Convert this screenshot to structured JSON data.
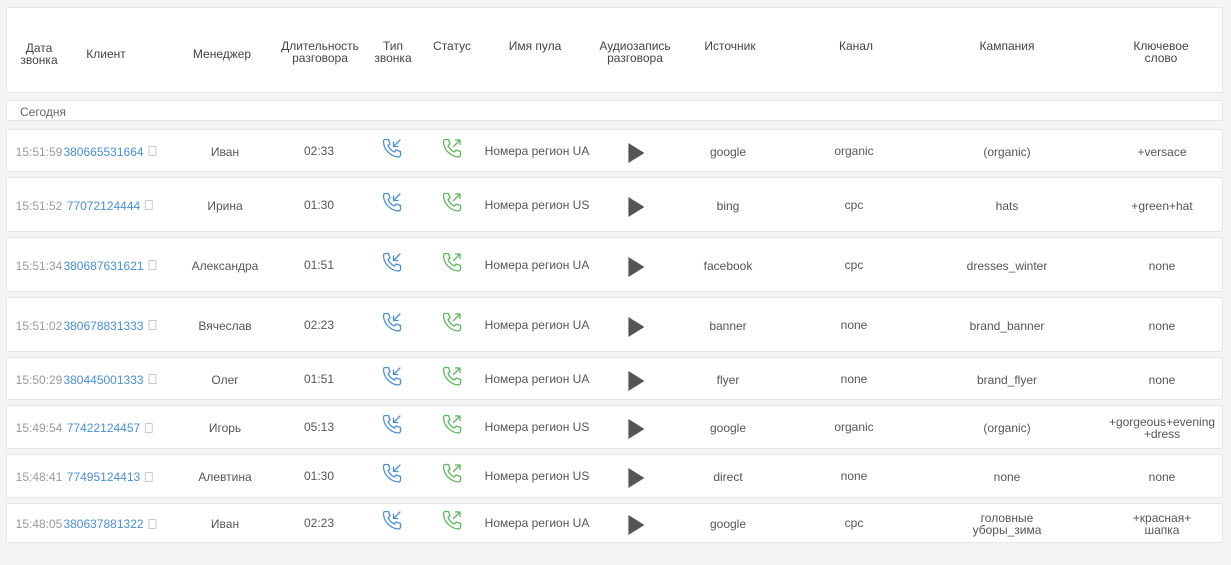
{
  "header": {
    "date": [
      "Дата",
      "звонка"
    ],
    "client": "Клиент",
    "manager": "Менеджер",
    "duration": [
      "Длительность",
      "разговора"
    ],
    "type": [
      "Тип",
      "звонка"
    ],
    "status": "Статус",
    "pool": "Имя пула",
    "audio": [
      "Аудиозапись",
      "разговора"
    ],
    "source": "Источник",
    "channel": "Канал",
    "campaign": "Кампания",
    "keyword": [
      "Ключевое",
      "слово"
    ]
  },
  "group_label": "Сегодня",
  "icons": {
    "call_type": "incoming-call-icon",
    "status": "answered-call-icon",
    "audio": "play-icon",
    "copy": "copy-icon"
  },
  "colors": {
    "phone_link": "#4a8fd6",
    "incoming_icon": "#4a8fd6",
    "status_icon": "#5cb85c"
  },
  "rows": [
    {
      "time": "15:51:59",
      "phone": "380665531664",
      "manager": "Иван",
      "duration": "02:33",
      "pool": "Номера регион UA",
      "source": "google",
      "channel": "organic",
      "campaign": [
        "(organic)"
      ],
      "keyword": [
        "+versace"
      ]
    },
    {
      "time": "15:51:52",
      "phone": "77072124444",
      "manager": "Ирина",
      "duration": "01:30",
      "pool": "Номера регион US",
      "source": "bing",
      "channel": "cpc",
      "campaign": [
        "hats"
      ],
      "keyword": [
        "+green+hat"
      ]
    },
    {
      "time": "15:51:34",
      "phone": "380687631621",
      "manager": "Александра",
      "duration": "01:51",
      "pool": "Номера регион UA",
      "source": "facebook",
      "channel": "cpc",
      "campaign": [
        "dresses_winter"
      ],
      "keyword": [
        "none"
      ]
    },
    {
      "time": "15:51:02",
      "phone": "380678831333",
      "manager": "Вячеслав",
      "duration": "02:23",
      "pool": "Номера регион UA",
      "source": "banner",
      "channel": "none",
      "campaign": [
        "brand_banner"
      ],
      "keyword": [
        "none"
      ]
    },
    {
      "time": "15:50:29",
      "phone": "380445001333",
      "manager": "Олег",
      "duration": "01:51",
      "pool": "Номера регион UA",
      "source": "flyer",
      "channel": "none",
      "campaign": [
        "brand_flyer"
      ],
      "keyword": [
        "none"
      ]
    },
    {
      "time": "15:49:54",
      "phone": "77422124457",
      "manager": "Игорь",
      "duration": "05:13",
      "pool": "Номера регион US",
      "source": "google",
      "channel": "organic",
      "campaign": [
        "(organic)"
      ],
      "keyword": [
        "+gorgeous+evening",
        "+dress"
      ]
    },
    {
      "time": "15:48:41",
      "phone": "77495124413",
      "manager": "Алевтина",
      "duration": "01:30",
      "pool": "Номера регион US",
      "source": "direct",
      "channel": "none",
      "campaign": [
        "none"
      ],
      "keyword": [
        "none"
      ]
    },
    {
      "time": "15:48:05",
      "phone": "380637881322",
      "manager": "Иван",
      "duration": "02:23",
      "pool": "Номера регион UA",
      "source": "google",
      "channel": "cpc",
      "campaign": [
        "головные",
        "уборы_зима"
      ],
      "keyword": [
        "+красная+",
        "шапка"
      ]
    }
  ]
}
